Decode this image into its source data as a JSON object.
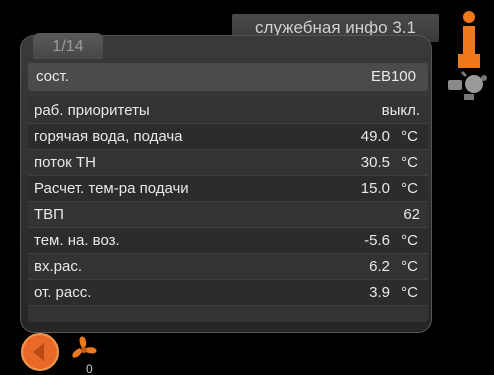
{
  "header": {
    "title": "служебная инфо  3.1"
  },
  "tab": {
    "label": "1/14"
  },
  "status": {
    "label": "сост.",
    "value": "EB100"
  },
  "rows": [
    {
      "label": "раб. приоритеты",
      "value": "выкл.",
      "unit": ""
    },
    {
      "label": "горячая вода, подача",
      "value": "49.0",
      "unit": "°C"
    },
    {
      "label": "поток ТН",
      "value": "30.5",
      "unit": "°C"
    },
    {
      "label": "Расчет. тем-ра подачи",
      "value": "15.0",
      "unit": "°C"
    },
    {
      "label": "ТВП",
      "value": "62",
      "unit": ""
    },
    {
      "label": "тем. на. воз.",
      "value": "-5.6",
      "unit": "°C"
    },
    {
      "label": "вх.рас.",
      "value": "6.2",
      "unit": "°C"
    },
    {
      "label": "от. расс.",
      "value": "3.9",
      "unit": "°C"
    }
  ],
  "fan": {
    "label": "0"
  },
  "icons": {
    "status": "info-icon",
    "remote": "remote-control-icon",
    "back": "back-button-icon",
    "fan": "fan-icon"
  },
  "colors": {
    "accent": "#f07a1a",
    "panel": "#333333"
  }
}
